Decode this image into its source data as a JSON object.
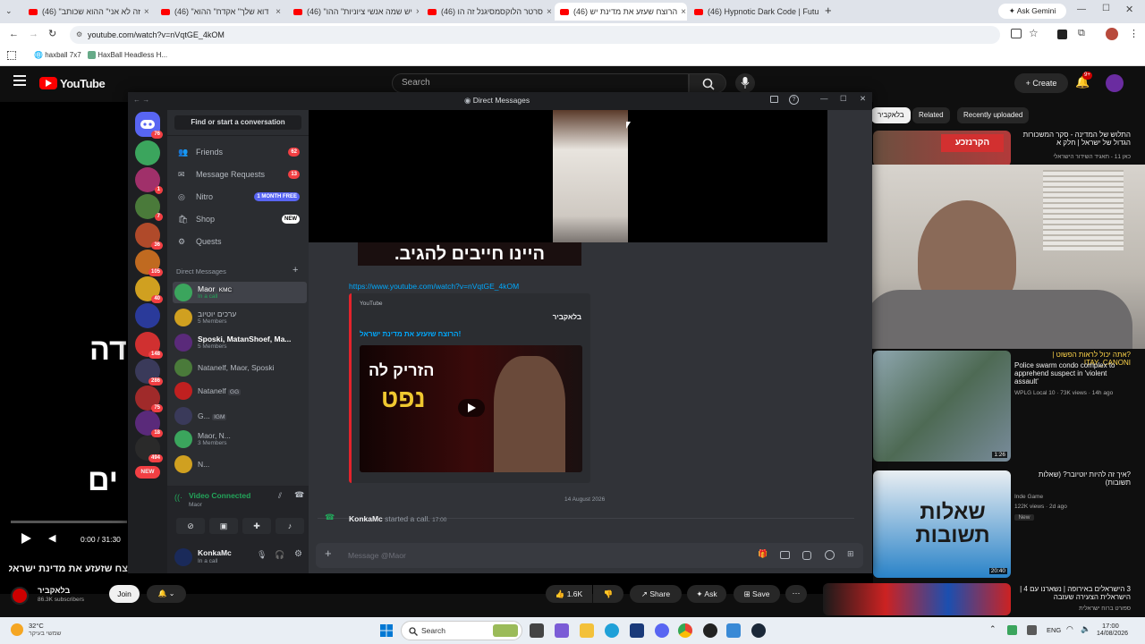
{
  "browser": {
    "tabs": [
      {
        "label": "(46) \"זה לא אני\" ההוא שכותב"
      },
      {
        "label": "(46) \"דוא שלך\" אקדח\" ההוא"
      },
      {
        "label": "(46) \"יש שמה אנשי ציוניות\" ההו"
      },
      {
        "label": "(46) סרטר הלוקסמסיגנל זה הו"
      },
      {
        "label": "(46) הרוצח שעזע את מדינת יש"
      },
      {
        "label": "(46) Hypnotic Dark Code | Futu"
      }
    ],
    "ask_gemini": "Ask Gemini",
    "url": "youtube.com/watch?v=nVqtGE_4kOM",
    "bookmarks": [
      "haxball 7x7",
      "HaxBall Headless H..."
    ]
  },
  "youtube": {
    "logo": "YouTube",
    "search_placeholder": "Search",
    "create_label": "Create",
    "notif_count": "9+",
    "chips": [
      "בלאקביר",
      "Related",
      "Recently uploaded"
    ],
    "player": {
      "time": "0:00 / 31:30",
      "overlay_text_1": "דה",
      "overlay_text_2": "ים"
    },
    "video_title": "הרוצח שזעזע את מדינת ישראל",
    "channel": {
      "name": "בלאקביר",
      "subs": "86.3K subscribers",
      "join": "Join"
    },
    "actions": {
      "likes": "1.6K",
      "share": "Share",
      "ask": "Ask",
      "save": "Save"
    },
    "recs": [
      {
        "title": "התלוש של המדינה - סקר המשכורות הגדול של ישראל | חלק א",
        "meta": "כאן 11 - תאגיד השידור הישראלי"
      },
      {
        "title": "?אתה יכול לראות הפשוט | ITAY_CANONI",
        "meta": "Police swarm condo complex to apprehend suspect in 'violent assault'",
        "extra": "WPLG Local 10 · 73K views · 14h ago",
        "duration": "1:26"
      },
      {
        "title": "?איך זה להיות יוטיובר? (שאלות תשובות)",
        "meta": "Inde Game",
        "extra": "122K views · 2d ago",
        "badge": "New",
        "duration": "20:40"
      },
      {
        "title": "3 הישראלים באירופה | נשארנו עם 4 | הישראלית הצעירה שעזבה",
        "meta": "ספורט ברוח ישראלית"
      }
    ],
    "rec_thumb_text": "שאלות תשובות"
  },
  "discord": {
    "title": "Direct Messages",
    "find_conversation": "Find or start a conversation",
    "nav": [
      {
        "label": "Friends",
        "badge": "62"
      },
      {
        "label": "Message Requests",
        "badge": "13"
      },
      {
        "label": "Nitro",
        "tag": "1 MONTH FREE"
      },
      {
        "label": "Shop",
        "tag": "NEW"
      },
      {
        "label": "Quests"
      }
    ],
    "dm_header": "Direct Messages",
    "dms": [
      {
        "name": "Maor",
        "tag": "KMC",
        "sub": "In a call"
      },
      {
        "name": "ערכים יוטיוב",
        "sub": "5 Members"
      },
      {
        "name": "Sposki, MatanShoef, Ma...",
        "sub": "5 Members"
      },
      {
        "name": "Natanelf, Maor, Sposki"
      },
      {
        "name": "Natanelf",
        "tag": "GG"
      },
      {
        "name": "G...",
        "tag": "IGM"
      },
      {
        "name": "Maor, N...",
        "sub": "3 Members"
      },
      {
        "name": "N..."
      }
    ],
    "server_badges": [
      "76",
      "1",
      "7",
      "36",
      "105",
      "40",
      "148",
      "286",
      "75",
      "18",
      "494",
      "NEW"
    ],
    "voice": {
      "status": "Video Connected",
      "channel": "Maor"
    },
    "user": {
      "name": "KonkaMc",
      "status": "In a call"
    },
    "chat": {
      "banner_text": "היינו חייבים להגיב.",
      "link": "https://www.youtube.com/watch?v=nVqtGE_4kOM",
      "embed_provider": "YouTube",
      "embed_author": "בלאקביר",
      "embed_title": "!הרוצח שזעזע את מדינת ישראל",
      "embed_thumb_line1": "הזריק לה",
      "embed_thumb_line2": "נפט",
      "date_divider": "14 August 2026",
      "call_user": "KonkaMc",
      "call_text": "started a call.",
      "call_time": "17:00",
      "message_placeholder": "Message @Maor"
    }
  },
  "taskbar": {
    "weather_temp": "32°C",
    "weather_desc": "שמשי בעיקר",
    "search": "Search",
    "lang": "ENG",
    "time": "17:00",
    "date": "14/08/2026"
  },
  "colors": {
    "yt_red": "#ff0000",
    "discord_blurple": "#5865f2",
    "discord_bg": "#313338",
    "link": "#00a8fc",
    "green": "#23a55a"
  }
}
